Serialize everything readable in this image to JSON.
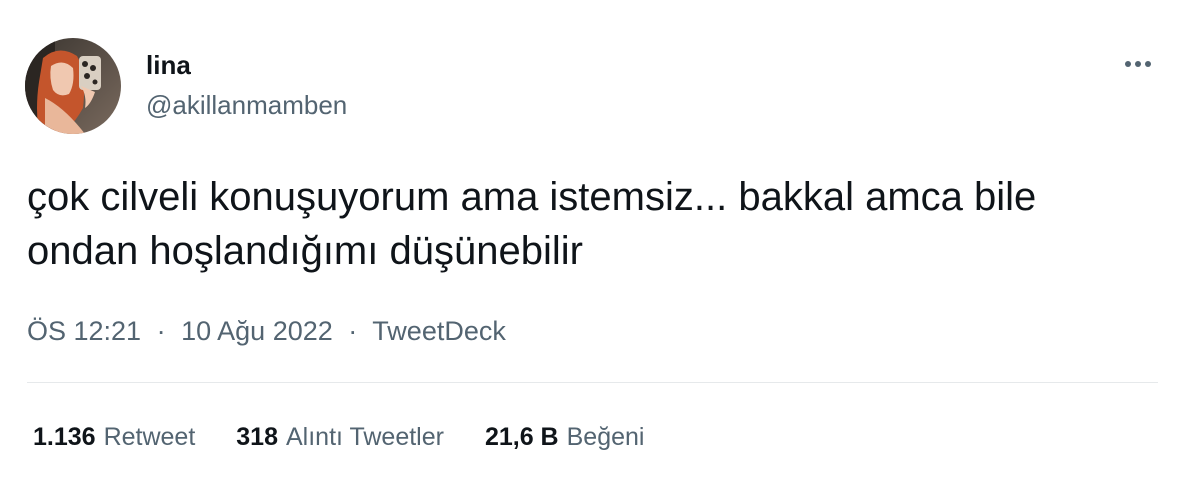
{
  "author": {
    "display_name": "lina",
    "handle": "@akillanmamben"
  },
  "tweet": {
    "text": "çok cilveli konuşuyorum ama istemsiz... bakkal amca bile ondan hoşlandığımı düşünebilir",
    "time": "ÖS 12:21",
    "date": "10 Ağu 2022",
    "separator": "·",
    "source": "TweetDeck"
  },
  "stats": {
    "retweets": {
      "count": "1.136",
      "label": "Retweet"
    },
    "quotes": {
      "count": "318",
      "label": "Alıntı Tweetler"
    },
    "likes": {
      "count": "21,6 B",
      "label": "Beğeni"
    }
  },
  "icons": {
    "more": "more-options-icon"
  },
  "colors": {
    "primary_text": "#0f1419",
    "secondary_text": "#536471",
    "divider": "#e6e9eb"
  }
}
